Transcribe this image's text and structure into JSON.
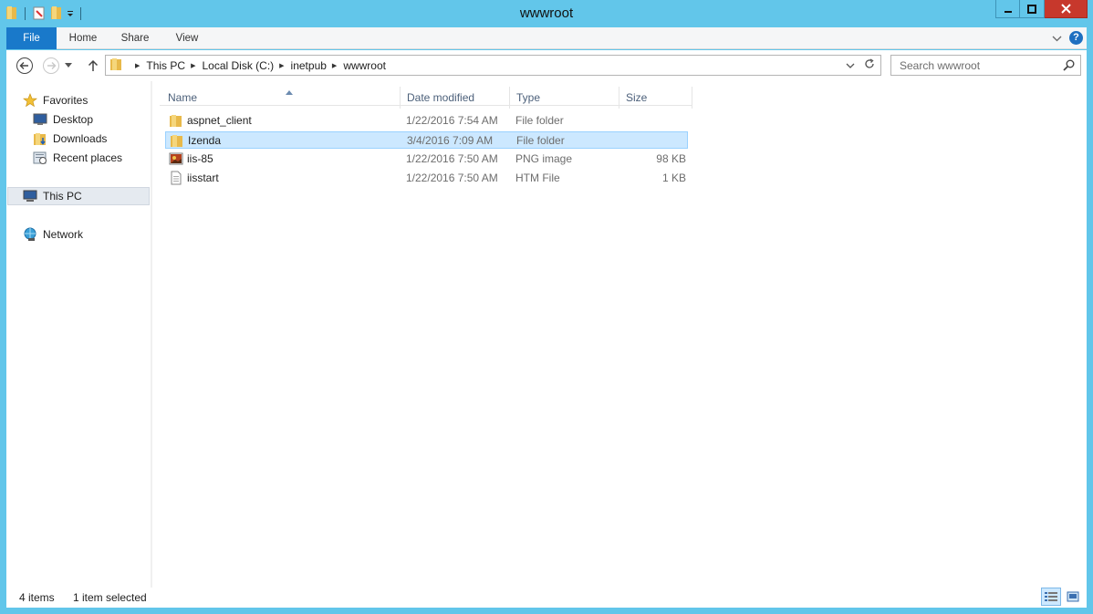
{
  "window": {
    "title": "wwwroot"
  },
  "ribbon": {
    "tabs": [
      {
        "label": "File"
      },
      {
        "label": "Home"
      },
      {
        "label": "Share"
      },
      {
        "label": "View"
      }
    ],
    "help_label": "?"
  },
  "address": {
    "crumbs": [
      "This PC",
      "Local Disk (C:)",
      "inetpub",
      "wwwroot"
    ]
  },
  "search": {
    "placeholder": "Search wwwroot"
  },
  "nav_pane": {
    "favorites": "Favorites",
    "items": [
      {
        "label": "Desktop",
        "icon": "desktop-icon"
      },
      {
        "label": "Downloads",
        "icon": "downloads-icon"
      },
      {
        "label": "Recent places",
        "icon": "recent-places-icon"
      }
    ],
    "this_pc": "This PC",
    "network": "Network"
  },
  "columns": {
    "name": "Name",
    "date": "Date modified",
    "type": "Type",
    "size": "Size"
  },
  "files": [
    {
      "name": "aspnet_client",
      "date": "1/22/2016 7:54 AM",
      "type": "File folder",
      "size": "",
      "icon": "folder-icon",
      "selected": false
    },
    {
      "name": "Izenda",
      "date": "3/4/2016 7:09 AM",
      "type": "File folder",
      "size": "",
      "icon": "folder-icon",
      "selected": true
    },
    {
      "name": "iis-85",
      "date": "1/22/2016 7:50 AM",
      "type": "PNG image",
      "size": "98 KB",
      "icon": "png-image-icon",
      "selected": false
    },
    {
      "name": "iisstart",
      "date": "1/22/2016 7:50 AM",
      "type": "HTM File",
      "size": "1 KB",
      "icon": "htm-file-icon",
      "selected": false
    }
  ],
  "status": {
    "items": "4 items",
    "selected": "1 item selected"
  },
  "colors": {
    "titlebar": "#62c6ea",
    "file_tab": "#1979ca",
    "selection": "#cce8ff",
    "close": "#c7382c"
  }
}
